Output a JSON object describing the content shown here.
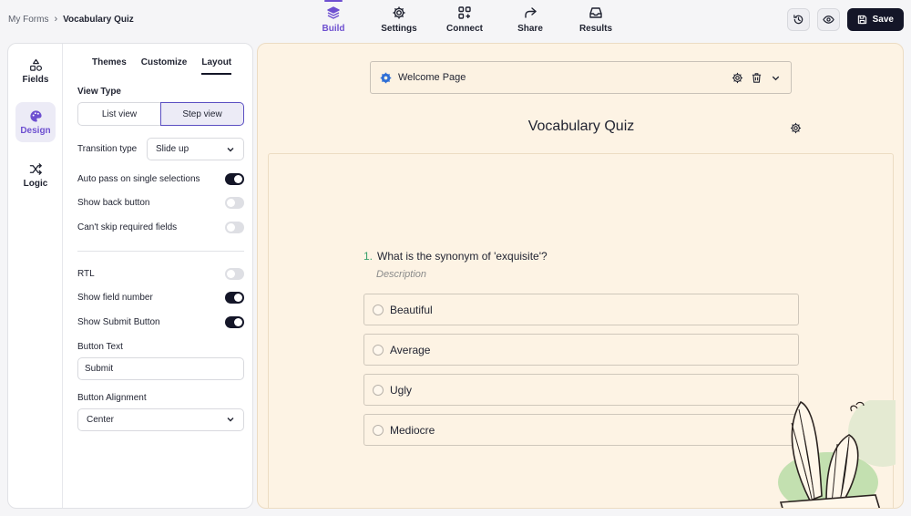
{
  "breadcrumb": {
    "parent": "My Forms",
    "separator": "›",
    "current": "Vocabulary Quiz"
  },
  "nav": {
    "tabs": [
      {
        "label": "Build",
        "icon": "layers-icon",
        "active": true
      },
      {
        "label": "Settings",
        "icon": "gear-icon",
        "active": false
      },
      {
        "label": "Connect",
        "icon": "grid-plus-icon",
        "active": false
      },
      {
        "label": "Share",
        "icon": "share-arrow-icon",
        "active": false
      },
      {
        "label": "Results",
        "icon": "inbox-icon",
        "active": false
      }
    ]
  },
  "actions": {
    "history_icon": "history-icon",
    "preview_icon": "eye-icon",
    "save_label": "Save"
  },
  "rail": {
    "items": [
      {
        "label": "Fields",
        "icon": "shapes-icon",
        "active": false
      },
      {
        "label": "Design",
        "icon": "palette-icon",
        "active": true
      },
      {
        "label": "Logic",
        "icon": "shuffle-icon",
        "active": false
      }
    ]
  },
  "settings": {
    "tabs": [
      {
        "label": "Themes",
        "active": false
      },
      {
        "label": "Customize",
        "active": false
      },
      {
        "label": "Layout",
        "active": true
      }
    ],
    "view_type": {
      "label": "View Type",
      "options": [
        "List view",
        "Step view"
      ],
      "selected": "Step view"
    },
    "transition": {
      "label": "Transition type",
      "value": "Slide up"
    },
    "toggles_a": [
      {
        "label": "Auto pass on single selections",
        "on": true
      },
      {
        "label": "Show back button",
        "on": false
      },
      {
        "label": "Can't skip required fields",
        "on": false
      }
    ],
    "toggles_b": [
      {
        "label": "RTL",
        "on": false
      },
      {
        "label": "Show field number",
        "on": true
      },
      {
        "label": "Show Submit Button",
        "on": true
      }
    ],
    "button_text": {
      "label": "Button Text",
      "value": "Submit"
    },
    "button_alignment": {
      "label": "Button Alignment",
      "value": "Center"
    }
  },
  "canvas": {
    "welcome_page": "Welcome Page",
    "title": "Vocabulary Quiz",
    "question": {
      "number": "1.",
      "text": "What is the synonym of 'exquisite'?",
      "description": "Description"
    },
    "options": [
      "Beautiful",
      "Average",
      "Ugly",
      "Mediocre"
    ]
  },
  "colors": {
    "accent": "#6e50d0",
    "dark": "#141628",
    "canvas_bg": "#fdf3e4",
    "number": "#3aa06b"
  }
}
